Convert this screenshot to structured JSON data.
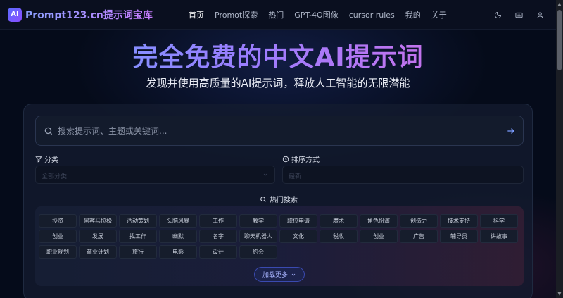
{
  "header": {
    "logo_badge": "AI",
    "logo_text": "Prompt123.cn提示词宝库",
    "nav": [
      "首页",
      "Promot探索",
      "热门",
      "GPT-4O图像",
      "cursor rules",
      "我的",
      "关于"
    ],
    "icons": [
      "moon-icon",
      "keyboard-icon",
      "user-icon"
    ]
  },
  "hero": {
    "title": "完全免费的中文AI提示词",
    "subtitle": "发现并使用高质量的AI提示词，释放人工智能的无限潜能"
  },
  "search": {
    "placeholder": "搜索提示词、主题或关键词..."
  },
  "filters": {
    "category_label": "分类",
    "category_value": "全部分类",
    "sort_label": "排序方式",
    "sort_value": "最新"
  },
  "hot": {
    "title": "热门搜索",
    "tags": [
      "投资",
      "黑客马拉松",
      "活动策划",
      "头脑风暴",
      "工作",
      "教学",
      "职位申请",
      "魔术",
      "角色扮演",
      "创造力",
      "技术支持",
      "科学",
      "创业",
      "发展",
      "找工作",
      "幽默",
      "名字",
      "聊天机器人",
      "文化",
      "税收",
      "创业",
      "广告",
      "辅导员",
      "讲故事",
      "职业规划",
      "商业计划",
      "旅行",
      "电影",
      "设计",
      "约会"
    ],
    "load_more": "加载更多"
  },
  "colors": {
    "background": "#050b1a",
    "accent": "#5b6cff",
    "title_gradient": [
      "#6fa0ff",
      "#9b7dff",
      "#e06be0"
    ]
  }
}
